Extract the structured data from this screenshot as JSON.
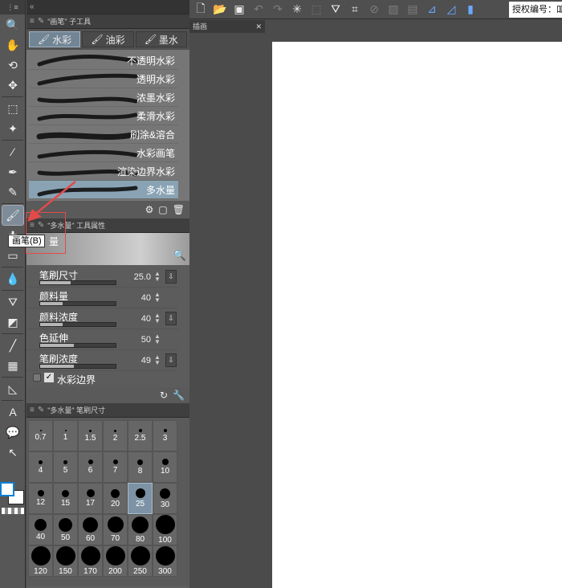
{
  "toolbar": {
    "header": "⋮≡",
    "tools": [
      {
        "name": "zoom-icon",
        "glyph": "🔍"
      },
      {
        "name": "hand-icon",
        "glyph": "✋"
      },
      {
        "name": "rotate-view-icon",
        "glyph": "⟲"
      },
      {
        "name": "move-icon",
        "glyph": "✥"
      },
      {
        "name": "selection-icon",
        "glyph": "⬚"
      },
      {
        "name": "magic-wand-icon",
        "glyph": "✦"
      },
      {
        "name": "eyedropper-icon",
        "glyph": "⁄"
      },
      {
        "name": "pen-icon",
        "glyph": "✒"
      },
      {
        "name": "pencil-icon",
        "glyph": "✎"
      },
      {
        "name": "brush-icon",
        "glyph": "🖌"
      },
      {
        "name": "airbrush-icon",
        "glyph": "✚"
      },
      {
        "name": "eraser-icon",
        "glyph": "▭"
      },
      {
        "name": "blend-icon",
        "glyph": "💧"
      },
      {
        "name": "fill-icon",
        "glyph": "⛛"
      },
      {
        "name": "gradient-icon",
        "glyph": "◩"
      },
      {
        "name": "line-icon",
        "glyph": "╱"
      },
      {
        "name": "frame-icon",
        "glyph": "▦"
      },
      {
        "name": "ruler-icon",
        "glyph": "◺"
      },
      {
        "name": "text-icon",
        "glyph": "A"
      },
      {
        "name": "balloon-icon",
        "glyph": "💬"
      },
      {
        "name": "correction-icon",
        "glyph": "↖"
      }
    ],
    "tooltip": "画笔(B)"
  },
  "subtool_panel": {
    "title": "\"画笔\" 子工具",
    "tabs": [
      {
        "label": "水彩",
        "selected": true
      },
      {
        "label": "油彩",
        "selected": false
      },
      {
        "label": "墨水",
        "selected": false
      }
    ],
    "brushes": [
      {
        "label": "不透明水彩",
        "selected": false
      },
      {
        "label": "透明水彩",
        "selected": false
      },
      {
        "label": "浓墨水彩",
        "selected": false
      },
      {
        "label": "柔滑水彩",
        "selected": false
      },
      {
        "label": "刷涂&溶合",
        "selected": false
      },
      {
        "label": "水彩画笔",
        "selected": false
      },
      {
        "label": "渲染边界水彩",
        "selected": false
      },
      {
        "label": "多水量",
        "selected": true
      }
    ]
  },
  "property_panel": {
    "title": "\"多水量\" 工具属性",
    "preview_label": "量",
    "properties": [
      {
        "label": "笔刷尺寸",
        "value": "25.0",
        "level": 0.4,
        "lock": true
      },
      {
        "label": "颜料量",
        "value": "40",
        "level": 0.3,
        "lock": false
      },
      {
        "label": "颜料浓度",
        "value": "40",
        "level": 0.3,
        "lock": true
      },
      {
        "label": "色延伸",
        "value": "50",
        "level": 0.45,
        "lock": false
      },
      {
        "label": "笔刷浓度",
        "value": "49",
        "level": 0.45,
        "lock": true
      }
    ],
    "checkbox_label": "水彩边界"
  },
  "size_panel": {
    "title": "\"多水量\" 笔刷尺寸",
    "sizes": [
      "0.7",
      "1",
      "1.5",
      "2",
      "2.5",
      "3",
      "4",
      "5",
      "6",
      "7",
      "8",
      "10",
      "12",
      "15",
      "17",
      "20",
      "25",
      "30",
      "40",
      "50",
      "60",
      "70",
      "80",
      "100",
      "120",
      "150",
      "170",
      "200",
      "250",
      "300"
    ],
    "selected": "25"
  },
  "canvas_tab": "插画",
  "license_label": "授权编号：吅"
}
